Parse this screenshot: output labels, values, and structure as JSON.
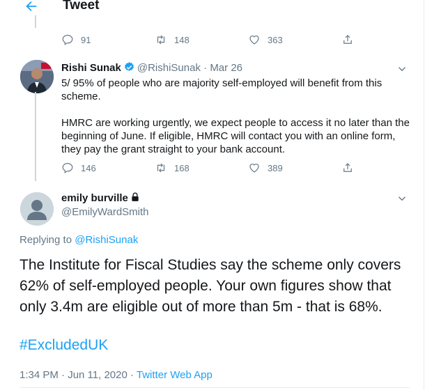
{
  "header": {
    "title": "Tweet",
    "back_icon": "arrow-left-icon"
  },
  "tweet1": {
    "actions": {
      "replies": "91",
      "retweets": "148",
      "likes": "363"
    }
  },
  "tweet2": {
    "name": "Rishi Sunak",
    "handle": "@RishiSunak",
    "separator": "·",
    "date": "Mar 26",
    "body": "5/ 95% of people who are majority self-employed will benefit from this scheme.\n\nHMRC are working urgently, we expect people to access it no later than the beginning of June. If eligible, HMRC will contact you with an online form, they pay the grant straight to your bank account.",
    "actions": {
      "replies": "146",
      "retweets": "168",
      "likes": "389"
    }
  },
  "tweet3": {
    "name": "emily burville",
    "handle": "@EmilyWardSmith",
    "replying_prefix": "Replying to",
    "replying_to": "@RishiSunak",
    "body": "The Institute for Fiscal Studies say the scheme only covers 62% of self-employed people. Your own figures show that only 3.4m are eligible out of more than 5m - that is 68%.",
    "hashtag": "#ExcludedUK",
    "timestamp": "1:34 PM · Jun 11, 2020 ·",
    "source": "Twitter Web App"
  },
  "colors": {
    "accent": "#1da1f2",
    "muted": "#657786",
    "text": "#14171a"
  }
}
